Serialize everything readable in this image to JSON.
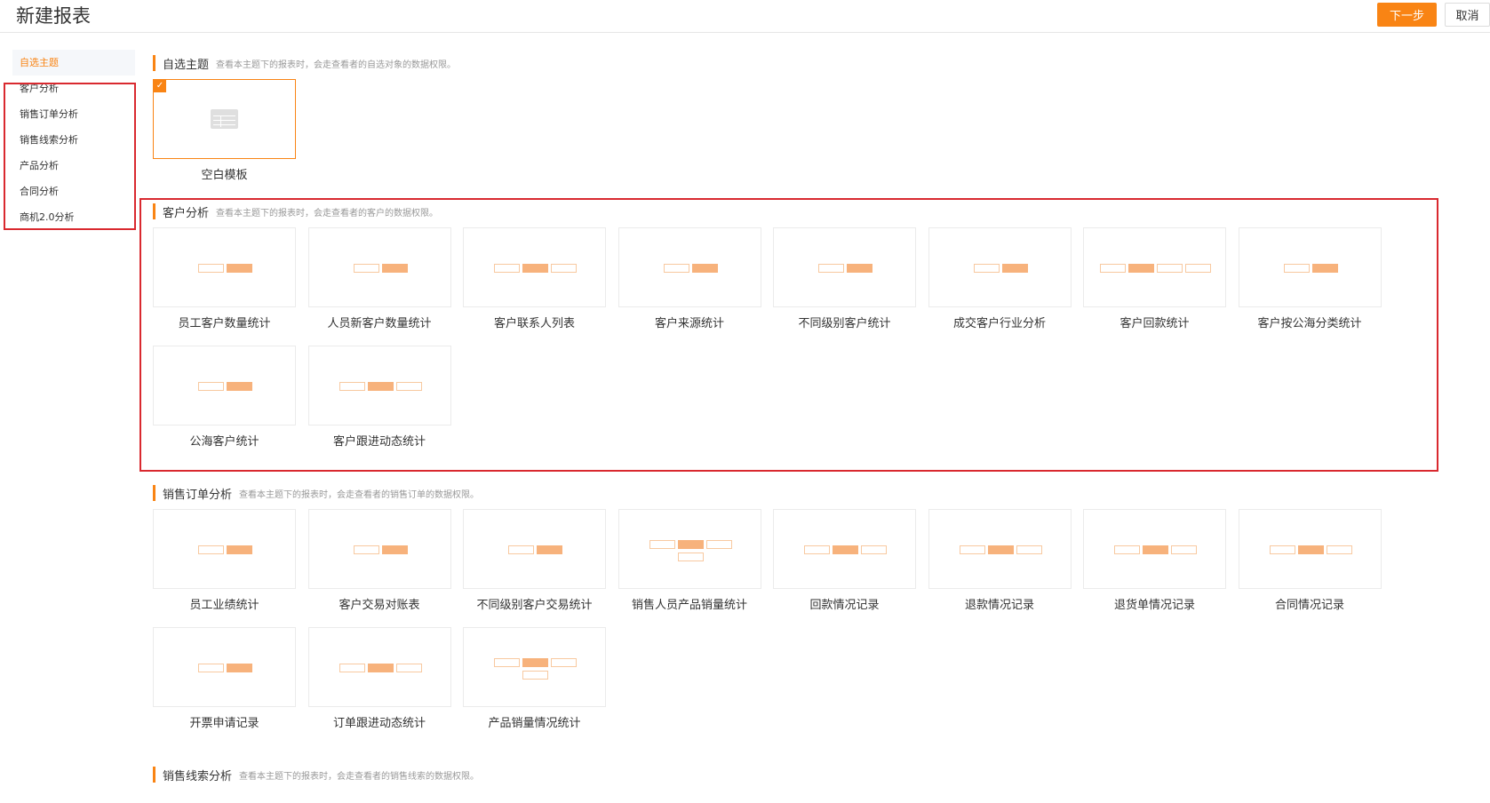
{
  "header": {
    "title": "新建报表",
    "next_label": "下一步",
    "cancel_label": "取消"
  },
  "sidebar": {
    "items": [
      {
        "label": "自选主题",
        "active": true
      },
      {
        "label": "客户分析"
      },
      {
        "label": "销售订单分析"
      },
      {
        "label": "销售线索分析"
      },
      {
        "label": "产品分析"
      },
      {
        "label": "合同分析"
      },
      {
        "label": "商机2.0分析"
      }
    ]
  },
  "sections": [
    {
      "title": "自选主题",
      "desc": "查看本主题下的报表时，会走查看者的自选对象的数据权限。",
      "cards": [
        {
          "label": "空白模板",
          "icon": "table-icon",
          "selected": true
        }
      ]
    },
    {
      "title": "客户分析",
      "desc": "查看本主题下的报表时，会走查看者的客户的数据权限。",
      "cards": [
        {
          "label": "员工客户数量统计",
          "blocks": 2
        },
        {
          "label": "人员新客户数量统计",
          "blocks": 2
        },
        {
          "label": "客户联系人列表",
          "blocks": 3
        },
        {
          "label": "客户来源统计",
          "blocks": 2
        },
        {
          "label": "不同级别客户统计",
          "blocks": 2
        },
        {
          "label": "成交客户行业分析",
          "blocks": 2
        },
        {
          "label": "客户回款统计",
          "blocks": 4
        },
        {
          "label": "客户按公海分类统计",
          "blocks": 2
        },
        {
          "label": "公海客户统计",
          "blocks": 2
        },
        {
          "label": "客户跟进动态统计",
          "blocks": 3
        }
      ]
    },
    {
      "title": "销售订单分析",
      "desc": "查看本主题下的报表时，会走查看者的销售订单的数据权限。",
      "cards": [
        {
          "label": "员工业绩统计",
          "blocks": 2
        },
        {
          "label": "客户交易对账表",
          "blocks": 2
        },
        {
          "label": "不同级别客户交易统计",
          "blocks": 2
        },
        {
          "label": "销售人员产品销量统计",
          "blocks": "tree"
        },
        {
          "label": "回款情况记录",
          "blocks": 3
        },
        {
          "label": "退款情况记录",
          "blocks": 3
        },
        {
          "label": "退货单情况记录",
          "blocks": 3
        },
        {
          "label": "合同情况记录",
          "blocks": 3
        },
        {
          "label": "开票申请记录",
          "blocks": 2
        },
        {
          "label": "订单跟进动态统计",
          "blocks": 3
        },
        {
          "label": "产品销量情况统计",
          "blocks": "tree"
        }
      ]
    },
    {
      "title": "销售线索分析",
      "desc": "查看本主题下的报表时，会走查看者的销售线索的数据权限。",
      "cards": []
    }
  ],
  "colors": {
    "accent": "#f98414",
    "highlight": "#d9292f",
    "block_fill": "#f7b27c",
    "block_border": "#f8c9a0"
  }
}
